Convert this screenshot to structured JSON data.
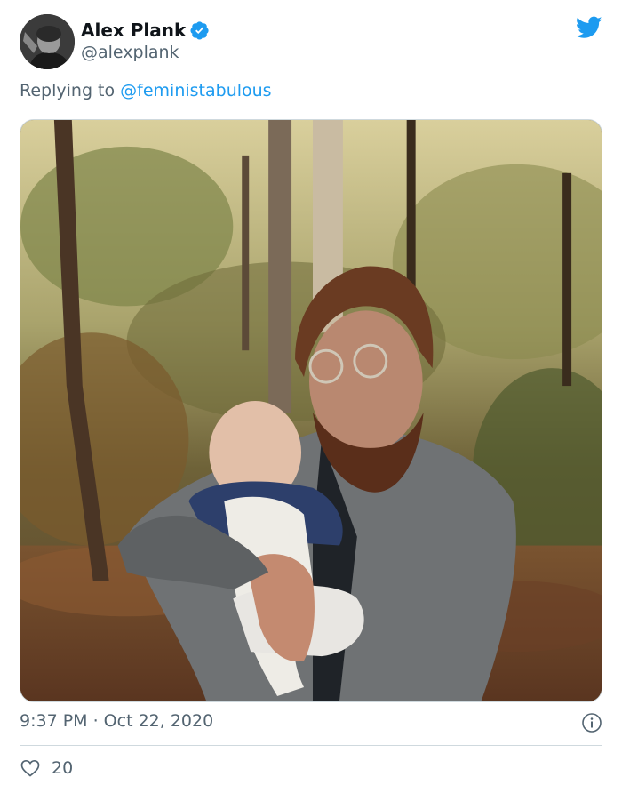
{
  "author": {
    "name": "Alex Plank",
    "handle": "@alexplank",
    "verified": true
  },
  "reply": {
    "prefix": "Replying to ",
    "mention": "@feministabulous"
  },
  "media": {
    "description_icon": "photo-of-man-holding-baby-in-woods"
  },
  "footer": {
    "timestamp": "9:37 PM · Oct 22, 2020",
    "like_count": "20"
  },
  "colors": {
    "brand": "#1d9bf0",
    "text_secondary": "#536471",
    "divider": "#cfd9de"
  },
  "icons": {
    "verified": "verified-badge-icon",
    "brand": "twitter-bird-icon",
    "info": "info-icon",
    "like": "heart-icon"
  }
}
